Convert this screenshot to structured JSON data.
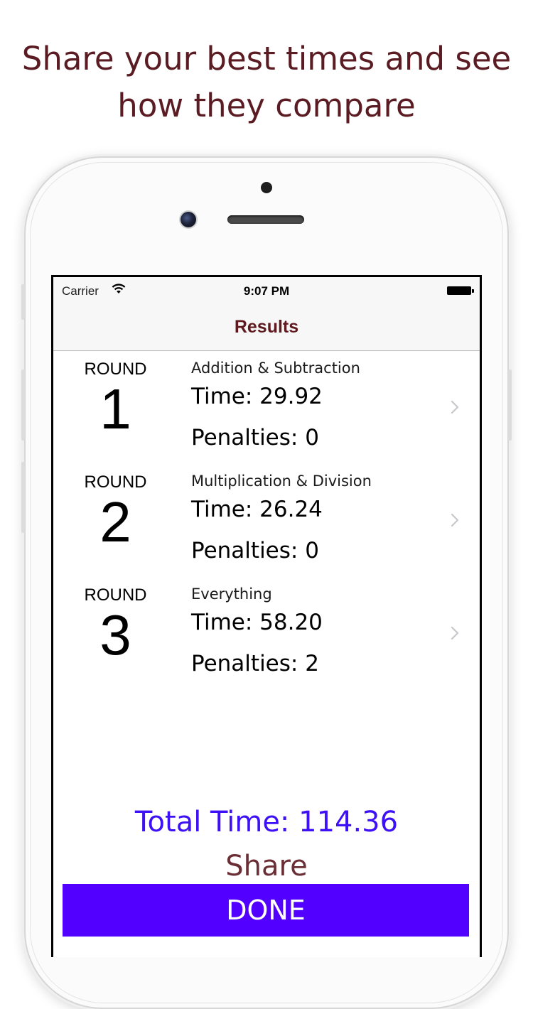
{
  "headline": {
    "line1": "Share your best times and see",
    "line2": "how they compare"
  },
  "status_bar": {
    "carrier": "Carrier",
    "time": "9:07 PM"
  },
  "nav": {
    "title": "Results"
  },
  "rounds": [
    {
      "label": "ROUND",
      "number": "1",
      "category": "Addition & Subtraction",
      "time": "Time: 29.92",
      "penalties": "Penalties: 0"
    },
    {
      "label": "ROUND",
      "number": "2",
      "category": "Multiplication & Division",
      "time": "Time: 26.24",
      "penalties": "Penalties: 0"
    },
    {
      "label": "ROUND",
      "number": "3",
      "category": "Everything",
      "time": "Time: 58.20",
      "penalties": "Penalties: 2"
    }
  ],
  "summary": {
    "total": "Total Time: 114.36",
    "share_label": "Share",
    "done_label": "DONE"
  },
  "colors": {
    "headline": "#5a1c22",
    "nav_title": "#5e1a1f",
    "total": "#3d10f5",
    "share": "#6b2e34",
    "done_button": "#5200ff"
  },
  "icons": {
    "wifi": "wifi-icon",
    "battery": "battery-icon",
    "chevron": "chevron-right-icon"
  }
}
